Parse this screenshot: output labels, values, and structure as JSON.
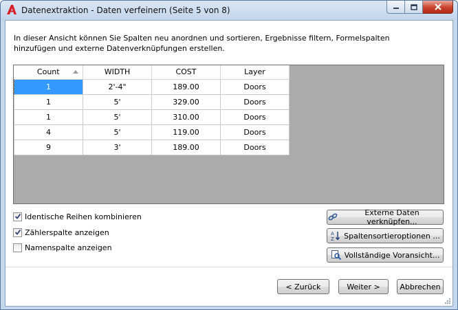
{
  "window": {
    "title": "Datenextraktion - Daten verfeinern (Seite 5 von 8)"
  },
  "description": "In dieser Ansicht können Sie Spalten neu anordnen und sortieren, Ergebnisse filtern, Formelspalten hinzufügen und externe Datenverknüpfungen erstellen.",
  "grid": {
    "columns": [
      "Count",
      "WIDTH",
      "COST",
      "Layer"
    ],
    "rows": [
      [
        "1",
        "2'-4\"",
        "189.00",
        "Doors"
      ],
      [
        "1",
        "5'",
        "329.00",
        "Doors"
      ],
      [
        "1",
        "5'",
        "310.00",
        "Doors"
      ],
      [
        "4",
        "5'",
        "119.00",
        "Doors"
      ],
      [
        "9",
        "3'",
        "189.00",
        "Doors"
      ]
    ]
  },
  "options": {
    "combine": {
      "label": "Identische Reihen kombinieren",
      "checked": true
    },
    "count_col": {
      "label": "Zählerspalte anzeigen",
      "checked": true
    },
    "name_col": {
      "label": "Namenspalte anzeigen",
      "checked": false
    }
  },
  "buttons": {
    "link_external": "Externe Daten verknüpfen...",
    "sort_options": "Spaltensortieroptionen ...",
    "full_preview": "Vollständige Voransicht...",
    "back": "< Zurück",
    "next": "Weiter >",
    "cancel": "Abbrechen"
  }
}
